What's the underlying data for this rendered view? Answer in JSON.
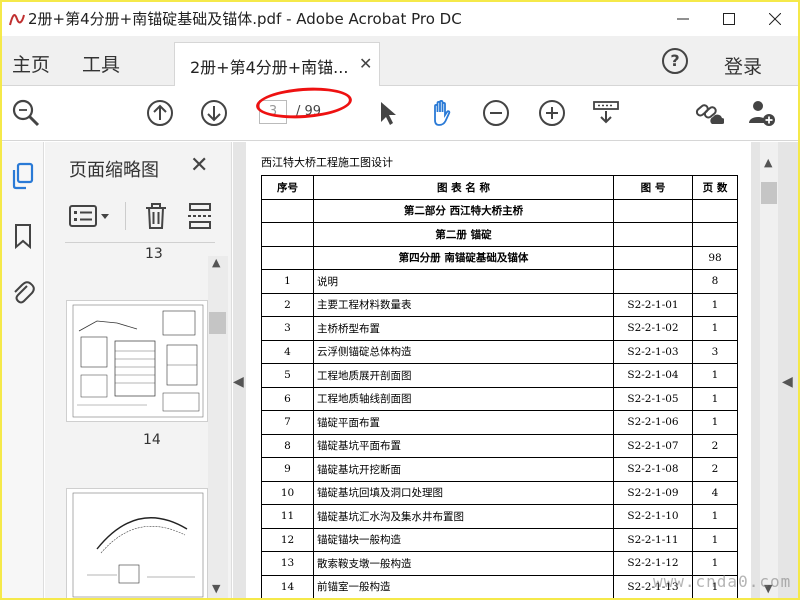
{
  "window": {
    "title": "2册+第4分册+南锚碇基础及锚体.pdf - Adobe Acrobat Pro DC"
  },
  "tabs": {
    "home": "主页",
    "tools": "工具",
    "document": "2册+第4分册+南锚...",
    "login": "登录",
    "help": "?"
  },
  "toolbar": {
    "page_current": "3",
    "page_total": "/ 99"
  },
  "thumbnails": {
    "title": "页面缩略图",
    "pages": [
      {
        "label": "13"
      },
      {
        "label": "14"
      }
    ]
  },
  "document": {
    "header": "西江特大桥工程施工图设计",
    "columns": [
      "序号",
      "图 表 名 称",
      "图 号",
      "页 数"
    ],
    "sections": [
      {
        "title": "第二部分 西江特大桥主桥",
        "pages": ""
      },
      {
        "title": "第二册 锚碇",
        "pages": ""
      },
      {
        "title": "第四分册 南锚碇基础及锚体",
        "pages": "98"
      }
    ],
    "rows": [
      {
        "no": "1",
        "name": "说明",
        "fig": "",
        "pages": "8"
      },
      {
        "no": "2",
        "name": "主要工程材料数量表",
        "fig": "S2-2-1-01",
        "pages": "1"
      },
      {
        "no": "3",
        "name": "主桥桥型布置",
        "fig": "S2-2-1-02",
        "pages": "1"
      },
      {
        "no": "4",
        "name": "云浮侧锚碇总体构造",
        "fig": "S2-2-1-03",
        "pages": "3"
      },
      {
        "no": "5",
        "name": "工程地质展开剖面图",
        "fig": "S2-2-1-04",
        "pages": "1"
      },
      {
        "no": "6",
        "name": "工程地质轴线剖面图",
        "fig": "S2-2-1-05",
        "pages": "1"
      },
      {
        "no": "7",
        "name": "锚碇平面布置",
        "fig": "S2-2-1-06",
        "pages": "1"
      },
      {
        "no": "8",
        "name": "锚碇基坑平面布置",
        "fig": "S2-2-1-07",
        "pages": "2"
      },
      {
        "no": "9",
        "name": "锚碇基坑开挖断面",
        "fig": "S2-2-1-08",
        "pages": "2"
      },
      {
        "no": "10",
        "name": "锚碇基坑回填及洞口处理图",
        "fig": "S2-2-1-09",
        "pages": "4"
      },
      {
        "no": "11",
        "name": "锚碇基坑汇水沟及集水井布置图",
        "fig": "S2-2-1-10",
        "pages": "1"
      },
      {
        "no": "12",
        "name": "锚碇锚块一般构造",
        "fig": "S2-2-1-11",
        "pages": "1"
      },
      {
        "no": "13",
        "name": "散索鞍支墩一般构造",
        "fig": "S2-2-1-12",
        "pages": "1"
      },
      {
        "no": "14",
        "name": "前锚室一般构造",
        "fig": "S2-2-1-13",
        "pages": "1"
      }
    ],
    "watermark": "www.cnda0.com"
  },
  "colors": {
    "accent_blue": "#2a7ad6",
    "annotation_red": "#e11111",
    "frame_yellow": "#f5e94a"
  }
}
